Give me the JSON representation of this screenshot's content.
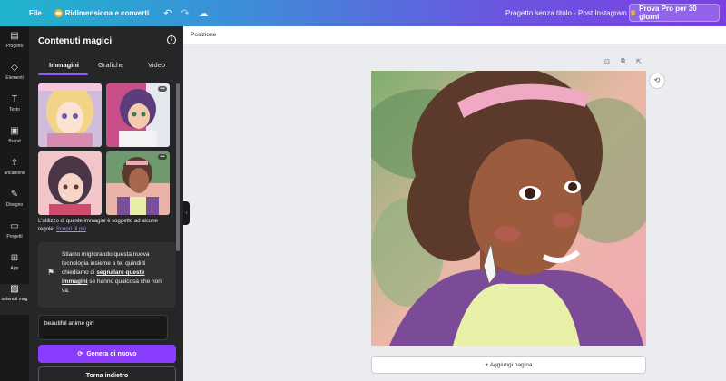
{
  "topbar": {
    "file": "File",
    "resize": "Ridimensiona e converti",
    "undo_icon": "undo-icon",
    "redo_icon": "redo-icon",
    "cloud_icon": "cloud-sync-icon",
    "title": "Progetto senza titolo - Post Instagram",
    "pro_button": "Prova Pro per 30 giorni",
    "accent": "#7b3fe4"
  },
  "rail": {
    "items": [
      {
        "label": "Progetto",
        "icon": "layout-icon"
      },
      {
        "label": "Elementi",
        "icon": "shapes-icon"
      },
      {
        "label": "Testo",
        "icon": "text-icon"
      },
      {
        "label": "Brand",
        "icon": "brand-icon"
      },
      {
        "label": "aricamenti",
        "icon": "upload-icon"
      },
      {
        "label": "Disegno",
        "icon": "draw-icon"
      },
      {
        "label": "Progetti",
        "icon": "folder-icon"
      },
      {
        "label": "App",
        "icon": "apps-icon"
      },
      {
        "label": "ontenuti mag",
        "icon": "magic-media-icon"
      }
    ]
  },
  "panel": {
    "title": "Contenuti magici",
    "tabs": [
      "Immagini",
      "Grafiche",
      "Video"
    ],
    "notice_text": "L'utilizzo di queste immagini è soggetto ad alcune regole.",
    "notice_link": "Scopri di più",
    "feedback_pre": "Stiamo migliorando questa nuova tecnologia insieme a te, quindi ti chiediamo di",
    "feedback_link": "segnalare queste immagini",
    "feedback_post": "se hanno qualcosa che non va.",
    "prompt_value": "beautiful anime girl",
    "generate_button": "Genera di nuovo",
    "back_button": "Torna indietro"
  },
  "editor": {
    "position_label": "Posizione",
    "add_page": "+ Aggiungi pagina"
  }
}
